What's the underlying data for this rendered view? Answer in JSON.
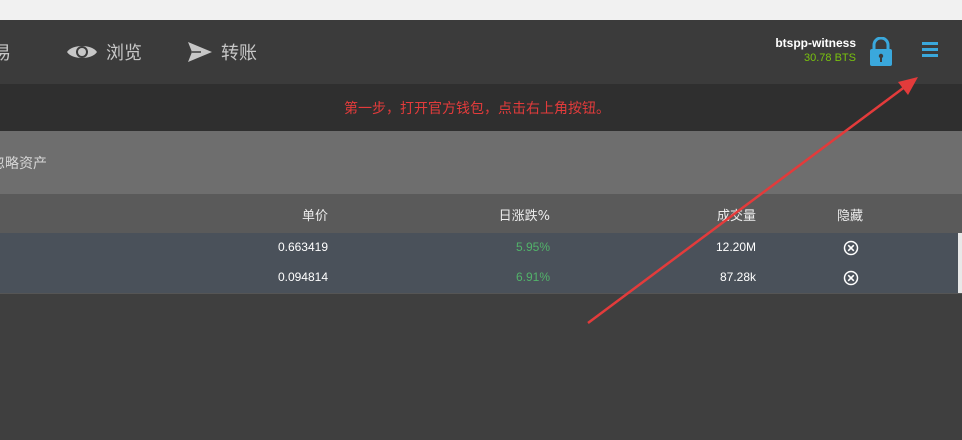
{
  "nav": {
    "items": [
      {
        "label": "易",
        "icon": "exchange-icon"
      },
      {
        "label": "浏览",
        "icon": "eye-icon"
      },
      {
        "label": "转账",
        "icon": "send-icon"
      }
    ]
  },
  "account": {
    "name": "btspp-witness",
    "balance": "30.78 BTS"
  },
  "notice": {
    "text": "第一步，打开官方钱包，点击右上角按钮。"
  },
  "filter": {
    "label": "忽略资产"
  },
  "table": {
    "headers": {
      "price": "单价",
      "change": "日涨跌%",
      "volume": "成交量",
      "hide": "隐藏"
    },
    "rows": [
      {
        "price": "0.663419",
        "change": "5.95%",
        "volume": "12.20M"
      },
      {
        "price": "0.094814",
        "change": "6.91%",
        "volume": "87.28k"
      }
    ]
  },
  "colors": {
    "accent": "#3aa8dc",
    "balance": "#79c20e",
    "positive_change": "#52b36a",
    "annotation": "#e33b3b"
  }
}
